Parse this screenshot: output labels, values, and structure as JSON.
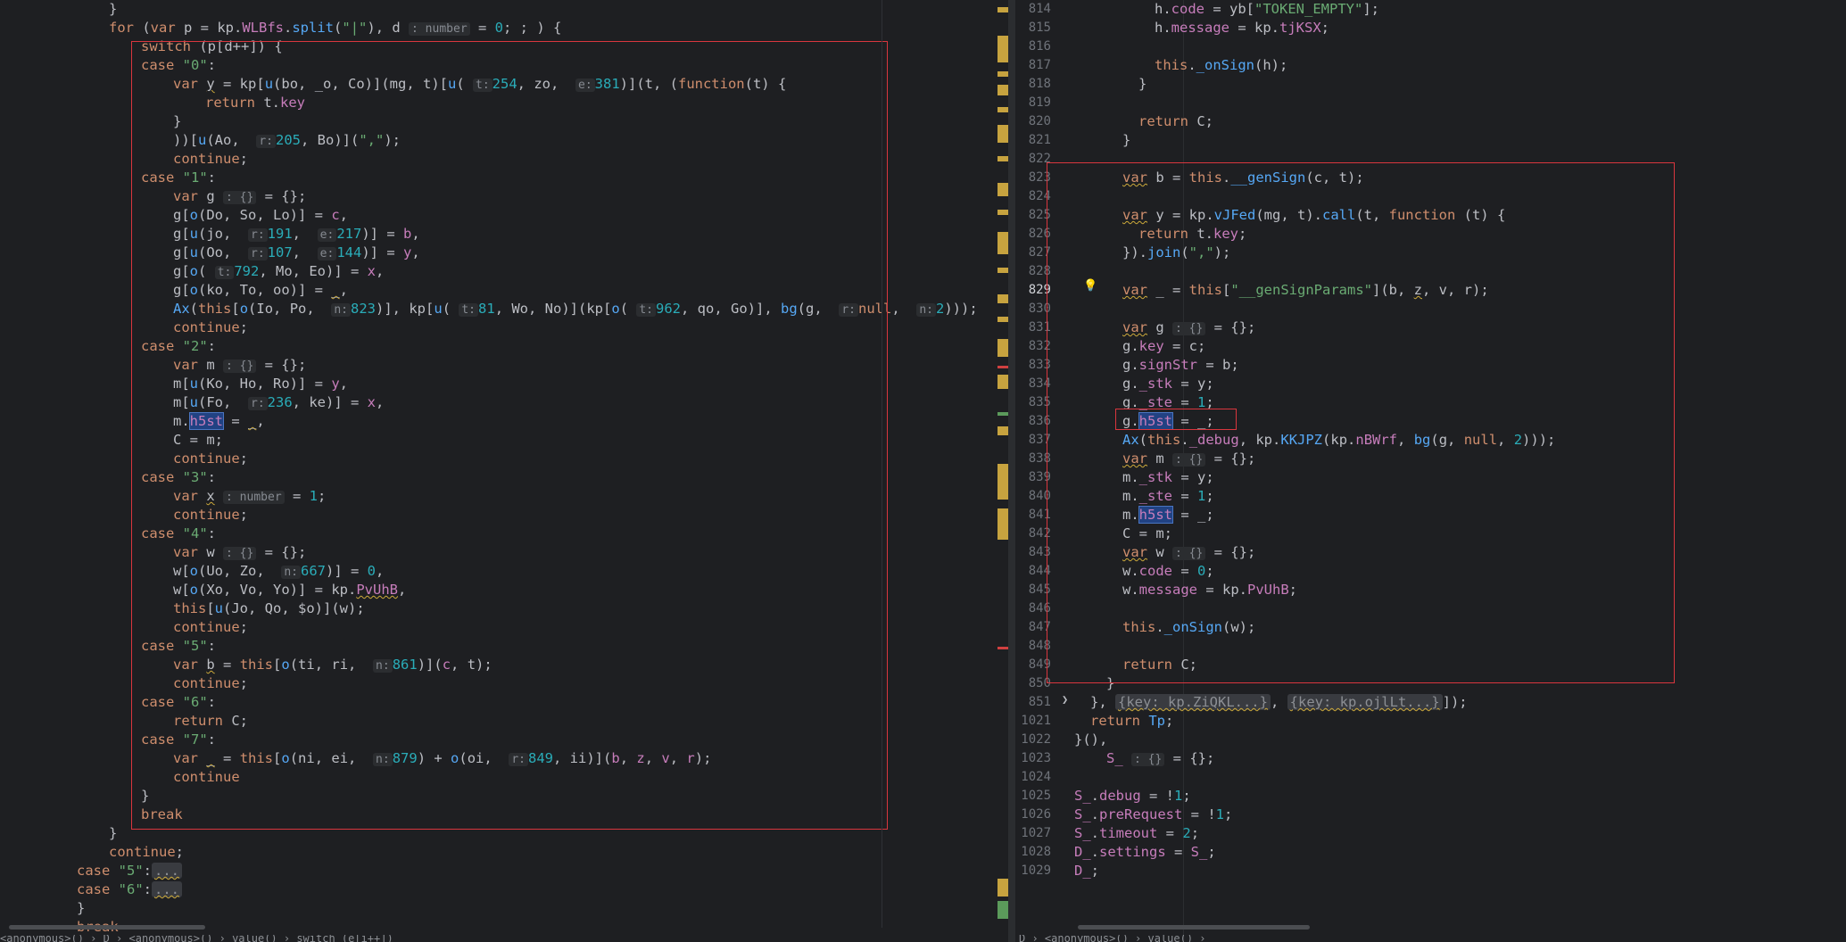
{
  "left_editor": {
    "breadcrumb": "<anonymous>() › D › <anonymous>() › value() › switch (e[i++])"
  },
  "right_editor": {
    "breadcrumb": "D › <anonymous>() › value() ›",
    "line_numbers": [
      "814",
      "815",
      "816",
      "817",
      "818",
      "819",
      "820",
      "821",
      "822",
      "823",
      "824",
      "825",
      "826",
      "827",
      "828",
      "829",
      "830",
      "831",
      "832",
      "833",
      "834",
      "835",
      "836",
      "837",
      "838",
      "839",
      "840",
      "841",
      "842",
      "843",
      "844",
      "845",
      "846",
      "847",
      "848",
      "849",
      "850",
      "851",
      "1021",
      "1022",
      "1023",
      "1024",
      "1025",
      "1026",
      "1027",
      "1028",
      "1029"
    ],
    "current_line": "829"
  },
  "icons": {
    "bulb": "lightbulb-icon",
    "fold": "chevron-right-icon"
  }
}
